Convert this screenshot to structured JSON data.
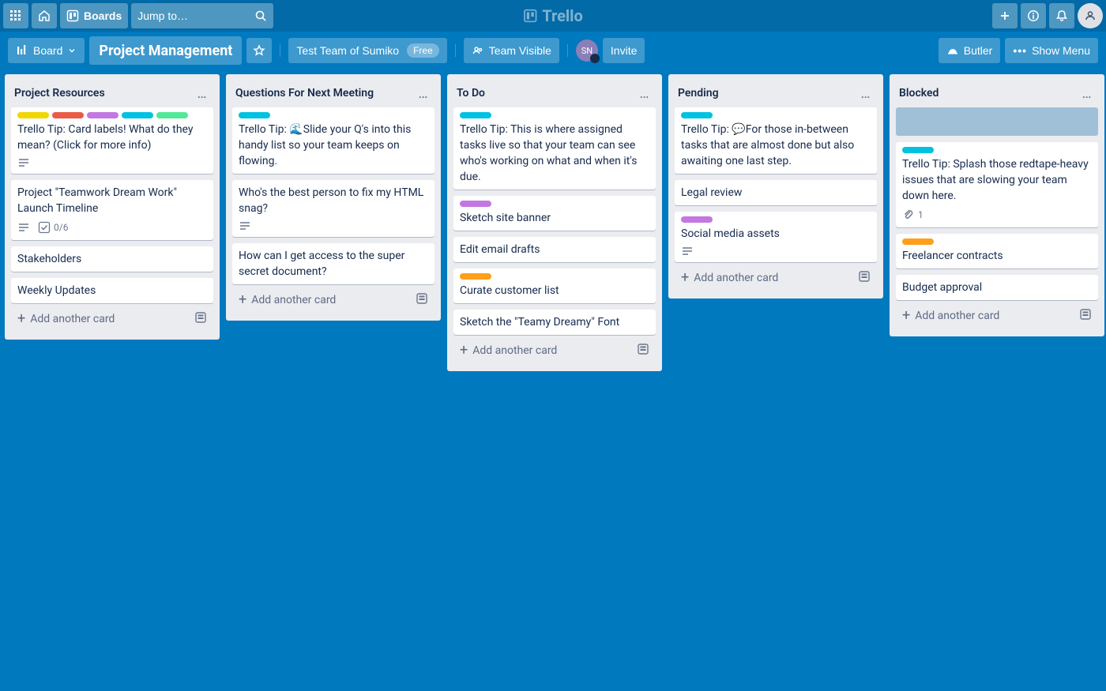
{
  "header": {
    "boards_label": "Boards",
    "search_placeholder": "Jump to…",
    "brand": "Trello"
  },
  "boardbar": {
    "view_label": "Board",
    "board_name": "Project Management",
    "team_label": "Test Team of Sumiko",
    "free_label": "Free",
    "visibility": "Team Visible",
    "invite": "Invite",
    "butler": "Butler",
    "show_menu": "Show Menu",
    "member_initials": "SN"
  },
  "add_card_label": "Add another card",
  "lists": [
    {
      "title": "Project Resources",
      "cards": [
        {
          "labels": [
            "yellow",
            "red",
            "purple",
            "sky",
            "lime"
          ],
          "text": "Trello Tip: Card labels! What do they mean? (Click for more info)",
          "badges": {
            "desc": true
          }
        },
        {
          "text": "Project \"Teamwork Dream Work\" Launch Timeline",
          "badges": {
            "desc": true,
            "checklist": "0/6"
          }
        },
        {
          "text": "Stakeholders"
        },
        {
          "text": "Weekly Updates"
        }
      ]
    },
    {
      "title": "Questions For Next Meeting",
      "cards": [
        {
          "labels": [
            "sky"
          ],
          "text": "Trello Tip: 🌊Slide your Q's into this handy list so your team keeps on flowing."
        },
        {
          "text": "Who's the best person to fix my HTML snag?",
          "badges": {
            "desc": true
          }
        },
        {
          "text": "How can I get access to the super secret document?"
        }
      ]
    },
    {
      "title": "To Do",
      "cards": [
        {
          "labels": [
            "sky"
          ],
          "text": "Trello Tip: This is where assigned tasks live so that your team can see who's working on what and when it's due."
        },
        {
          "labels": [
            "purple"
          ],
          "text": "Sketch site banner"
        },
        {
          "text": "Edit email drafts"
        },
        {
          "labels": [
            "orange"
          ],
          "text": "Curate customer list"
        },
        {
          "text": "Sketch the \"Teamy Dreamy\" Font"
        }
      ]
    },
    {
      "title": "Pending",
      "cards": [
        {
          "labels": [
            "sky"
          ],
          "text": "Trello Tip: 💬For those in-between tasks that are almost done but also awaiting one last step."
        },
        {
          "text": "Legal review"
        },
        {
          "labels": [
            "purple"
          ],
          "text": "Social media assets",
          "badges": {
            "desc": true
          }
        }
      ]
    },
    {
      "title": "Blocked",
      "cards": [
        {
          "placeholder": true
        },
        {
          "labels": [
            "sky"
          ],
          "text": "Trello Tip: Splash those redtape-heavy issues that are slowing your team down here.",
          "badges": {
            "attach": "1"
          }
        },
        {
          "labels": [
            "orange"
          ],
          "text": "Freelancer contracts"
        },
        {
          "text": "Budget approval"
        }
      ]
    }
  ]
}
